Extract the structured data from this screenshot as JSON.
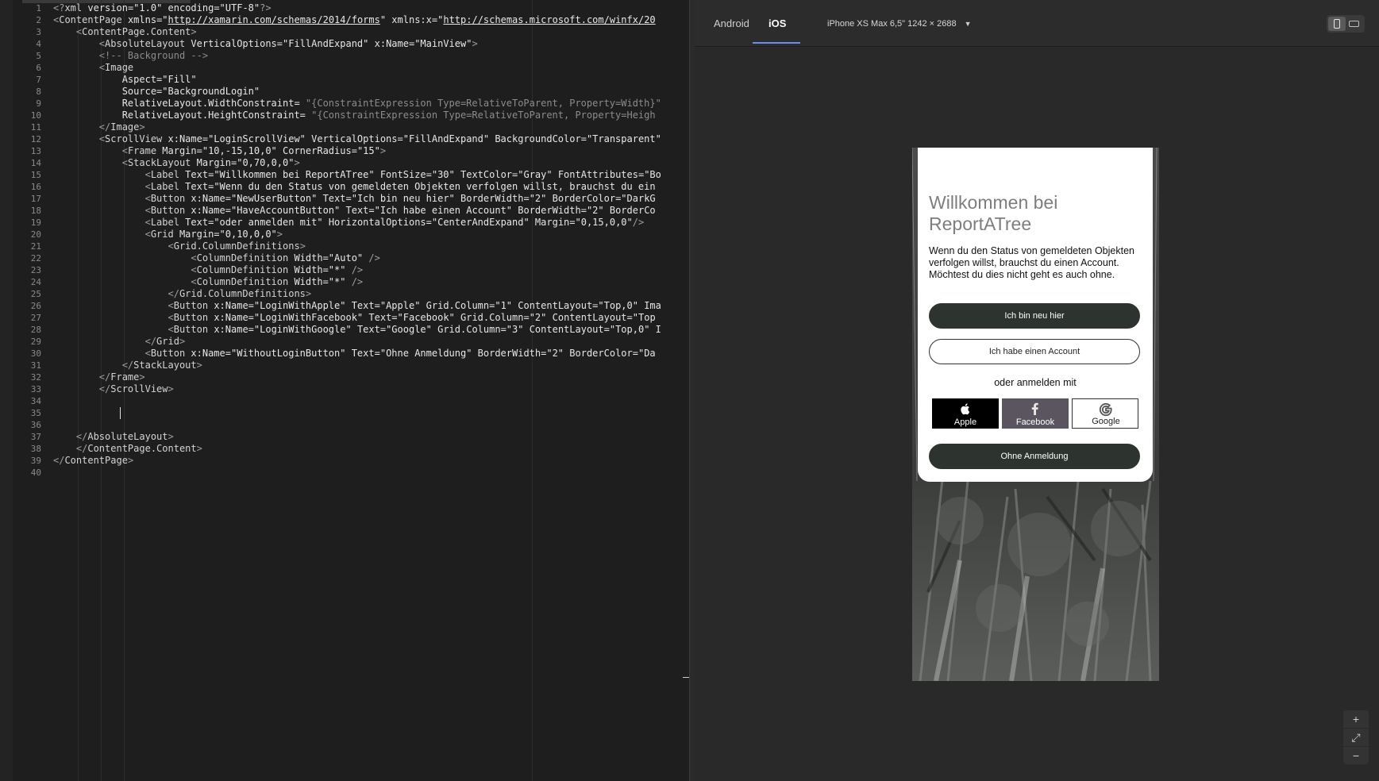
{
  "editor": {
    "lines": [
      [
        [
          "punc",
          "<?"
        ],
        [
          "tag",
          "xml"
        ],
        [
          "attr",
          " version="
        ],
        [
          "str",
          "\"1.0\""
        ],
        [
          "attr",
          " encoding="
        ],
        [
          "str",
          "\"UTF-8\""
        ],
        [
          "punc",
          "?>"
        ]
      ],
      [
        [
          "punc",
          "<"
        ],
        [
          "tag",
          "ContentPage"
        ],
        [
          "attr",
          " xmlns="
        ],
        [
          "str",
          "\""
        ],
        [
          "url",
          "http://xamarin.com/schemas/2014/forms"
        ],
        [
          "str",
          "\""
        ],
        [
          "attr",
          " xmlns:x="
        ],
        [
          "str",
          "\""
        ],
        [
          "url",
          "http://schemas.microsoft.com/winfx/20"
        ]
      ],
      [
        [
          "plain",
          "    "
        ],
        [
          "punc",
          "<"
        ],
        [
          "tag",
          "ContentPage.Content"
        ],
        [
          "punc",
          ">"
        ]
      ],
      [
        [
          "plain",
          "        "
        ],
        [
          "punc",
          "<"
        ],
        [
          "tag",
          "AbsoluteLayout"
        ],
        [
          "attr",
          " VerticalOptions="
        ],
        [
          "str",
          "\"FillAndExpand\""
        ],
        [
          "attr",
          " x:Name="
        ],
        [
          "str",
          "\"MainView\""
        ],
        [
          "punc",
          ">"
        ]
      ],
      [
        [
          "plain",
          "        "
        ],
        [
          "comment",
          "<!-- Background -->"
        ]
      ],
      [
        [
          "plain",
          "        "
        ],
        [
          "punc",
          "<"
        ],
        [
          "tag",
          "Image"
        ]
      ],
      [
        [
          "plain",
          "            "
        ],
        [
          "attr",
          "Aspect="
        ],
        [
          "str",
          "\"Fill\""
        ]
      ],
      [
        [
          "plain",
          "            "
        ],
        [
          "attr",
          "Source="
        ],
        [
          "str",
          "\"BackgroundLogin\""
        ]
      ],
      [
        [
          "plain",
          "            "
        ],
        [
          "attr",
          "RelativeLayout.WidthConstraint= "
        ],
        [
          "comment",
          "\"{ConstraintExpression Type=RelativeToParent, Property=Width}\""
        ]
      ],
      [
        [
          "plain",
          "            "
        ],
        [
          "attr",
          "RelativeLayout.HeightConstraint= "
        ],
        [
          "comment",
          "\"{ConstraintExpression Type=RelativeToParent, Property=Heigh"
        ]
      ],
      [
        [
          "plain",
          "        "
        ],
        [
          "punc",
          "</"
        ],
        [
          "tag",
          "Image"
        ],
        [
          "punc",
          ">"
        ]
      ],
      [
        [
          "plain",
          "        "
        ],
        [
          "punc",
          "<"
        ],
        [
          "tag",
          "ScrollView"
        ],
        [
          "attr",
          " x:Name="
        ],
        [
          "str",
          "\"LoginScrollView\""
        ],
        [
          "attr",
          " VerticalOptions="
        ],
        [
          "str",
          "\"FillAndExpand\""
        ],
        [
          "attr",
          " BackgroundColor="
        ],
        [
          "str",
          "\"Transparent\""
        ]
      ],
      [
        [
          "plain",
          "            "
        ],
        [
          "punc",
          "<"
        ],
        [
          "tag",
          "Frame"
        ],
        [
          "attr",
          " Margin="
        ],
        [
          "str",
          "\"10,-15,10,0\""
        ],
        [
          "attr",
          " CornerRadius="
        ],
        [
          "str",
          "\"15\""
        ],
        [
          "punc",
          ">"
        ]
      ],
      [
        [
          "plain",
          "            "
        ],
        [
          "punc",
          "<"
        ],
        [
          "tag",
          "StackLayout"
        ],
        [
          "attr",
          " Margin="
        ],
        [
          "str",
          "\"0,70,0,0\""
        ],
        [
          "punc",
          ">"
        ]
      ],
      [
        [
          "plain",
          "                "
        ],
        [
          "punc",
          "<"
        ],
        [
          "tag",
          "Label"
        ],
        [
          "attr",
          " Text="
        ],
        [
          "str",
          "\"Willkommen bei ReportATree\""
        ],
        [
          "attr",
          " FontSize="
        ],
        [
          "str",
          "\"30\""
        ],
        [
          "attr",
          " TextColor="
        ],
        [
          "str",
          "\"Gray\""
        ],
        [
          "attr",
          " FontAttributes="
        ],
        [
          "str",
          "\"Bo"
        ]
      ],
      [
        [
          "plain",
          "                "
        ],
        [
          "punc",
          "<"
        ],
        [
          "tag",
          "Label"
        ],
        [
          "attr",
          " Text="
        ],
        [
          "str",
          "\"Wenn du den Status von gemeldeten Objekten verfolgen willst, brauchst du ein"
        ]
      ],
      [
        [
          "plain",
          "                "
        ],
        [
          "punc",
          "<"
        ],
        [
          "tag",
          "Button"
        ],
        [
          "attr",
          " x:Name="
        ],
        [
          "str",
          "\"NewUserButton\""
        ],
        [
          "attr",
          " Text="
        ],
        [
          "str",
          "\"Ich bin neu hier\""
        ],
        [
          "attr",
          " BorderWidth="
        ],
        [
          "str",
          "\"2\""
        ],
        [
          "attr",
          " BorderColor="
        ],
        [
          "str",
          "\"DarkG"
        ]
      ],
      [
        [
          "plain",
          "                "
        ],
        [
          "punc",
          "<"
        ],
        [
          "tag",
          "Button"
        ],
        [
          "attr",
          " x:Name="
        ],
        [
          "str",
          "\"HaveAccountButton\""
        ],
        [
          "attr",
          " Text="
        ],
        [
          "str",
          "\"Ich habe einen Account\""
        ],
        [
          "attr",
          " BorderWidth="
        ],
        [
          "str",
          "\"2\""
        ],
        [
          "attr",
          " BorderCo"
        ]
      ],
      [
        [
          "plain",
          "                "
        ],
        [
          "punc",
          "<"
        ],
        [
          "tag",
          "Label"
        ],
        [
          "attr",
          " Text="
        ],
        [
          "str",
          "\"oder anmelden mit\""
        ],
        [
          "attr",
          " HorizontalOptions="
        ],
        [
          "str",
          "\"CenterAndExpand\""
        ],
        [
          "attr",
          " Margin="
        ],
        [
          "str",
          "\"0,15,0,0\""
        ],
        [
          "punc",
          "/>"
        ]
      ],
      [
        [
          "plain",
          "                "
        ],
        [
          "punc",
          "<"
        ],
        [
          "tag",
          "Grid"
        ],
        [
          "attr",
          " Margin="
        ],
        [
          "str",
          "\"0,10,0,0\""
        ],
        [
          "punc",
          ">"
        ]
      ],
      [
        [
          "plain",
          "                    "
        ],
        [
          "punc",
          "<"
        ],
        [
          "tag",
          "Grid.ColumnDefinitions"
        ],
        [
          "punc",
          ">"
        ]
      ],
      [
        [
          "plain",
          "                        "
        ],
        [
          "punc",
          "<"
        ],
        [
          "tag",
          "ColumnDefinition"
        ],
        [
          "attr",
          " Width="
        ],
        [
          "str",
          "\"Auto\""
        ],
        [
          "punc",
          " />"
        ]
      ],
      [
        [
          "plain",
          "                        "
        ],
        [
          "punc",
          "<"
        ],
        [
          "tag",
          "ColumnDefinition"
        ],
        [
          "attr",
          " Width="
        ],
        [
          "str",
          "\"*\""
        ],
        [
          "punc",
          " />"
        ]
      ],
      [
        [
          "plain",
          "                        "
        ],
        [
          "punc",
          "<"
        ],
        [
          "tag",
          "ColumnDefinition"
        ],
        [
          "attr",
          " Width="
        ],
        [
          "str",
          "\"*\""
        ],
        [
          "punc",
          " />"
        ]
      ],
      [
        [
          "plain",
          "                    "
        ],
        [
          "punc",
          "</"
        ],
        [
          "tag",
          "Grid.ColumnDefinitions"
        ],
        [
          "punc",
          ">"
        ]
      ],
      [
        [
          "plain",
          "                    "
        ],
        [
          "punc",
          "<"
        ],
        [
          "tag",
          "Button"
        ],
        [
          "attr",
          " x:Name="
        ],
        [
          "str",
          "\"LoginWithApple\""
        ],
        [
          "attr",
          " Text="
        ],
        [
          "str",
          "\"Apple\""
        ],
        [
          "attr",
          " Grid.Column="
        ],
        [
          "str",
          "\"1\""
        ],
        [
          "attr",
          " ContentLayout="
        ],
        [
          "str",
          "\"Top,0\""
        ],
        [
          "attr",
          " Ima"
        ]
      ],
      [
        [
          "plain",
          "                    "
        ],
        [
          "punc",
          "<"
        ],
        [
          "tag",
          "Button"
        ],
        [
          "attr",
          " x:Name="
        ],
        [
          "str",
          "\"LoginWithFacebook\""
        ],
        [
          "attr",
          " Text="
        ],
        [
          "str",
          "\"Facebook\""
        ],
        [
          "attr",
          " Grid.Column="
        ],
        [
          "str",
          "\"2\""
        ],
        [
          "attr",
          " ContentLayout="
        ],
        [
          "str",
          "\"Top"
        ]
      ],
      [
        [
          "plain",
          "                    "
        ],
        [
          "punc",
          "<"
        ],
        [
          "tag",
          "Button"
        ],
        [
          "attr",
          " x:Name="
        ],
        [
          "str",
          "\"LoginWithGoogle\""
        ],
        [
          "attr",
          " Text="
        ],
        [
          "str",
          "\"Google\""
        ],
        [
          "attr",
          " Grid.Column="
        ],
        [
          "str",
          "\"3\""
        ],
        [
          "attr",
          " ContentLayout="
        ],
        [
          "str",
          "\"Top,0\""
        ],
        [
          "attr",
          " I"
        ]
      ],
      [
        [
          "plain",
          "                "
        ],
        [
          "punc",
          "</"
        ],
        [
          "tag",
          "Grid"
        ],
        [
          "punc",
          ">"
        ]
      ],
      [
        [
          "plain",
          "                "
        ],
        [
          "punc",
          "<"
        ],
        [
          "tag",
          "Button"
        ],
        [
          "attr",
          " x:Name="
        ],
        [
          "str",
          "\"WithoutLoginButton\""
        ],
        [
          "attr",
          " Text="
        ],
        [
          "str",
          "\"Ohne Anmeldung\""
        ],
        [
          "attr",
          " BorderWidth="
        ],
        [
          "str",
          "\"2\""
        ],
        [
          "attr",
          " BorderColor="
        ],
        [
          "str",
          "\"Da"
        ]
      ],
      [
        [
          "plain",
          "            "
        ],
        [
          "punc",
          "</"
        ],
        [
          "tag",
          "StackLayout"
        ],
        [
          "punc",
          ">"
        ]
      ],
      [
        [
          "plain",
          "        "
        ],
        [
          "punc",
          "</"
        ],
        [
          "tag",
          "Frame"
        ],
        [
          "punc",
          ">"
        ]
      ],
      [
        [
          "plain",
          "        "
        ],
        [
          "punc",
          "</"
        ],
        [
          "tag",
          "ScrollView"
        ],
        [
          "punc",
          ">"
        ]
      ],
      [
        [
          "plain",
          ""
        ]
      ],
      [
        [
          "plain",
          ""
        ]
      ],
      [
        [
          "plain",
          ""
        ]
      ],
      [
        [
          "plain",
          "    "
        ],
        [
          "punc",
          "</"
        ],
        [
          "tag",
          "AbsoluteLayout"
        ],
        [
          "punc",
          ">"
        ]
      ],
      [
        [
          "plain",
          "    "
        ],
        [
          "punc",
          "</"
        ],
        [
          "tag",
          "ContentPage.Content"
        ],
        [
          "punc",
          ">"
        ]
      ],
      [
        [
          "punc",
          "</"
        ],
        [
          "tag",
          "ContentPage"
        ],
        [
          "punc",
          ">"
        ]
      ],
      [
        [
          "plain",
          ""
        ]
      ]
    ]
  },
  "preview": {
    "tabs": [
      "Android",
      "iOS"
    ],
    "active_tab": "iOS",
    "device_label": "iPhone XS Max  6,5\" 1242 × 2688",
    "device_caret": "▼",
    "zoom_in": "+",
    "zoom_fit": "⤢",
    "zoom_out": "−"
  },
  "app": {
    "welcome_title": "Willkommen bei ReportATree",
    "description": "Wenn du den Status von gemeldeten Objekten verfolgen willst, brauchst du einen Account. Möchtest du dies nicht geht es auch ohne.",
    "new_user_button": "Ich bin neu hier",
    "have_account_button": "Ich habe einen Account",
    "or_login_with": "oder anmelden mit",
    "social": [
      {
        "label": "Apple",
        "icon": "apple-icon"
      },
      {
        "label": "Facebook",
        "icon": "facebook-icon"
      },
      {
        "label": "Google",
        "icon": "google-icon"
      }
    ],
    "without_login_button": "Ohne Anmeldung"
  }
}
